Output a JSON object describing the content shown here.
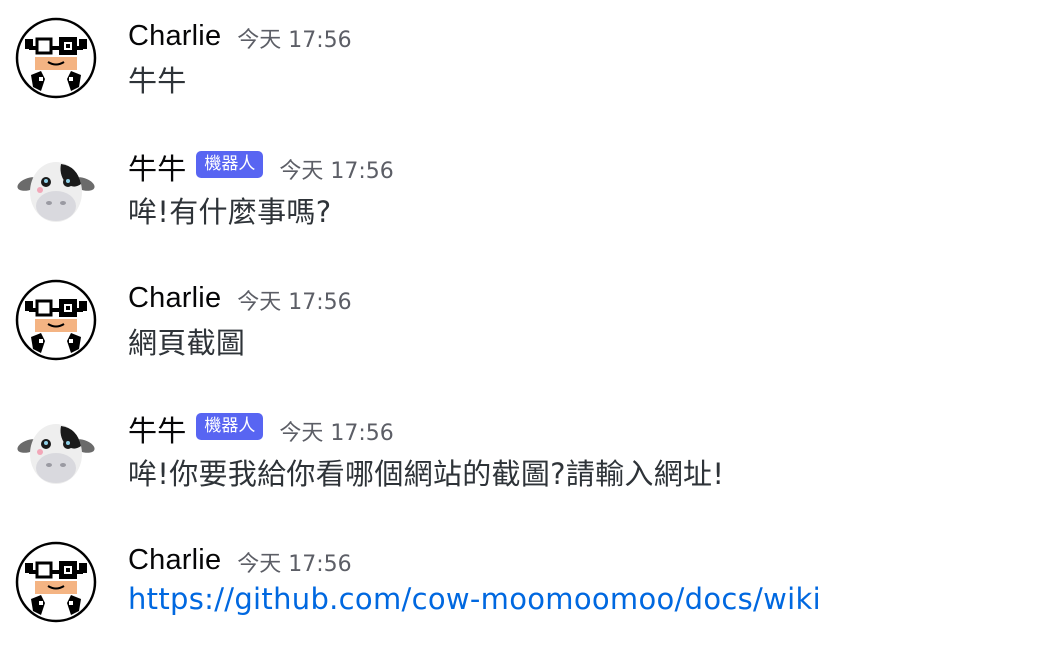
{
  "messages": [
    {
      "author": "Charlie",
      "avatar": "charlie-cow-avatar-icon",
      "timestamp": "今天 17:56",
      "text": "牛牛"
    },
    {
      "author": "牛牛",
      "avatar": "plush-cow-avatar-icon",
      "bot_tag": "機器人",
      "timestamp": "今天 17:56",
      "text": "哞!有什麼事嗎?"
    },
    {
      "author": "Charlie",
      "avatar": "charlie-cow-avatar-icon",
      "timestamp": "今天 17:56",
      "text": "網頁截圖"
    },
    {
      "author": "牛牛",
      "avatar": "plush-cow-avatar-icon",
      "bot_tag": "機器人",
      "timestamp": "今天 17:56",
      "text": "哞!你要我給你看哪個網站的截圖?請輸入網址!"
    },
    {
      "author": "Charlie",
      "avatar": "charlie-cow-avatar-icon",
      "timestamp": "今天 17:56",
      "link": "https://github.com/cow-moomoomoo/docs/wiki"
    }
  ],
  "colors": {
    "bot_tag_bg": "#5865f2",
    "link": "#0068e0",
    "timestamp": "#5c5e66",
    "text": "#2e3338"
  }
}
